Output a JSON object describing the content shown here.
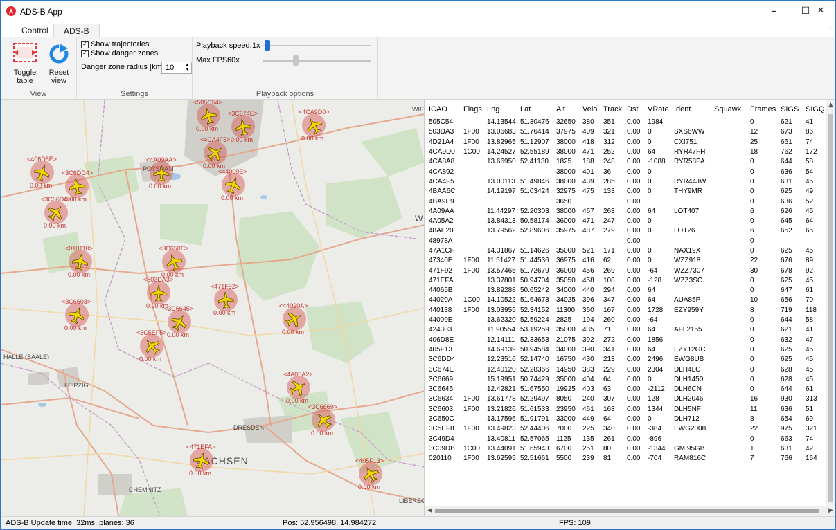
{
  "window": {
    "title": "ADS-B App",
    "minimize": "–",
    "maximize": "☐",
    "close": "✕"
  },
  "tabs": [
    {
      "label": "Control"
    },
    {
      "label": "ADS-B"
    }
  ],
  "ribbon": {
    "view": {
      "label": "View",
      "toggle_table": "Toggle\ntable",
      "toggle_table_l1": "Toggle",
      "toggle_table_l2": "table",
      "reset_view_l1": "Reset",
      "reset_view_l2": "view"
    },
    "settings": {
      "label": "Settings",
      "show_trajectories": "Show trajectories",
      "show_danger_zones": "Show danger zones",
      "danger_radius_label": "Danger zone radius [km]",
      "danger_radius_value": "10"
    },
    "playback": {
      "label": "Playback options",
      "speed_label": "Playback speed:",
      "speed_value": "1x",
      "speed_level": 0.02,
      "fps_label": "Max FPS:",
      "fps_value": "60x",
      "fps_level": 0.3
    }
  },
  "map": {
    "places": [
      {
        "name": "W"
      },
      {
        "name": "WIE"
      },
      {
        "name": "HALLE (SAALE)"
      },
      {
        "name": "LEIPZIG"
      },
      {
        "name": "CHEMNITZ"
      },
      {
        "name": "DRESDEN"
      },
      {
        "name": "POTSDAM"
      },
      {
        "name": "SACHSEN"
      },
      {
        "name": "LIBEREC"
      }
    ],
    "planes": [
      {
        "label": "<4CA9D0>",
        "dist": "0.00 km"
      },
      {
        "label": "<406D8E>",
        "dist": "0.00 km"
      },
      {
        "label": "<3C6DD4>",
        "dist": "0.00 km"
      },
      {
        "label": "<3C66D4>",
        "dist": "0.00 km"
      },
      {
        "label": "<010110>",
        "dist": "0.00 km"
      },
      {
        "label": "<3C650C>",
        "dist": "0.00 km"
      },
      {
        "label": "<503DA3>",
        "dist": "0.00 km"
      },
      {
        "label": "<471F92>",
        "dist": "0.00 km"
      },
      {
        "label": "<3C6645>",
        "dist": "0.00 km"
      },
      {
        "label": "<3C6603>",
        "dist": "0.00 km"
      },
      {
        "label": "<3C5EF5>",
        "dist": "0.00 km"
      },
      {
        "label": "<44020A>",
        "dist": "0.00 km"
      },
      {
        "label": "<505C54>",
        "dist": "0.00 km"
      },
      {
        "label": "<471EFA>",
        "dist": "0.00 km"
      },
      {
        "label": "<405F13>",
        "dist": "0.00 km"
      },
      {
        "label": "<4A09AA>",
        "dist": "0.00 km"
      },
      {
        "label": "<4A05A2>",
        "dist": "0.00 km"
      },
      {
        "label": "<44009E>",
        "dist": "0.00 km"
      },
      {
        "label": "<3C6669>",
        "dist": "0.00 km"
      },
      {
        "label": "<4CA4F5>",
        "dist": "0.00 km"
      },
      {
        "label": "<3C674E>",
        "dist": "0.00 km"
      }
    ]
  },
  "table": {
    "columns": [
      "ICAO",
      "Flags",
      "Lng",
      "Lat",
      "Alt",
      "Velo",
      "Track",
      "Dst",
      "VRate",
      "Ident",
      "Squawk",
      "Frames",
      "SIGS",
      "SIGQ"
    ],
    "rows": [
      [
        "505C54",
        "",
        "14.13544",
        "51.30476",
        "32650",
        "380",
        "351",
        "0.00",
        "1984",
        "",
        "",
        "0",
        "621",
        "41"
      ],
      [
        "503DA3",
        "1F00",
        "13.06683",
        "51.76414",
        "37975",
        "409",
        "321",
        "0.00",
        "0",
        "SXS6WW",
        "",
        "12",
        "673",
        "86"
      ],
      [
        "4D21A4",
        "1F00",
        "13.82965",
        "51.12907",
        "38000",
        "418",
        "312",
        "0.00",
        "0",
        "CXI751",
        "",
        "25",
        "661",
        "74"
      ],
      [
        "4CA9D0",
        "1C00",
        "14.24527",
        "52.55189",
        "38000",
        "471",
        "252",
        "0.00",
        "64",
        "RYR47FH",
        "",
        "18",
        "762",
        "172"
      ],
      [
        "4CA8A8",
        "",
        "13.66950",
        "52.41130",
        "1825",
        "188",
        "248",
        "0.00",
        "-1088",
        "RYR58PA",
        "",
        "0",
        "644",
        "58"
      ],
      [
        "4CA892",
        "",
        "",
        "",
        "38000",
        "401",
        "36",
        "0.00",
        "0",
        "",
        "",
        "0",
        "636",
        "54"
      ],
      [
        "4CA4F5",
        "",
        "13.00113",
        "51.49846",
        "38000",
        "439",
        "285",
        "0.00",
        "0",
        "RYR44JW",
        "",
        "0",
        "631",
        "45"
      ],
      [
        "4BAA6C",
        "",
        "14.19197",
        "51.03424",
        "32975",
        "475",
        "133",
        "0.00",
        "0",
        "THY9MR",
        "",
        "0",
        "625",
        "49"
      ],
      [
        "4BA9E9",
        "",
        "",
        "",
        "3650",
        "",
        "",
        "0.00",
        "",
        "",
        "",
        "0",
        "636",
        "52"
      ],
      [
        "4A09AA",
        "",
        "11.44297",
        "52.20303",
        "38000",
        "467",
        "263",
        "0.00",
        "64",
        "LOT407",
        "",
        "6",
        "626",
        "45"
      ],
      [
        "4A05A2",
        "",
        "13.84313",
        "50.58174",
        "36000",
        "471",
        "247",
        "0.00",
        "0",
        "",
        "",
        "0",
        "645",
        "64"
      ],
      [
        "48AE20",
        "",
        "13.79562",
        "52.89606",
        "35975",
        "487",
        "279",
        "0.00",
        "0",
        "LOT26",
        "",
        "6",
        "652",
        "65"
      ],
      [
        "48978A",
        "",
        "",
        "",
        "",
        "",
        "",
        "0.00",
        "",
        "",
        "",
        "0",
        "",
        ""
      ],
      [
        "47A1CF",
        "",
        "14.31867",
        "51.14626",
        "35000",
        "521",
        "171",
        "0.00",
        "0",
        "NAX19X",
        "",
        "0",
        "625",
        "45"
      ],
      [
        "47340E",
        "1F00",
        "11.51427",
        "51.44536",
        "36975",
        "416",
        "62",
        "0.00",
        "0",
        "WZZ918",
        "",
        "22",
        "676",
        "89"
      ],
      [
        "471F92",
        "1F00",
        "13.57465",
        "51.72679",
        "36000",
        "456",
        "269",
        "0.00",
        "-64",
        "WZZ7307",
        "",
        "30",
        "678",
        "92"
      ],
      [
        "471EFA",
        "",
        "13.37801",
        "50.94704",
        "35050",
        "458",
        "108",
        "0.00",
        "-128",
        "WZZ3SC",
        "",
        "0",
        "625",
        "45"
      ],
      [
        "44065B",
        "",
        "13.89288",
        "50.65242",
        "34000",
        "440",
        "294",
        "0.00",
        "64",
        "",
        "",
        "0",
        "647",
        "61"
      ],
      [
        "44020A",
        "1C00",
        "14.10522",
        "51.64673",
        "34025",
        "396",
        "347",
        "0.00",
        "64",
        "AUA85P",
        "",
        "10",
        "656",
        "70"
      ],
      [
        "440138",
        "1F00",
        "13.03955",
        "52.34152",
        "11300",
        "360",
        "167",
        "0.00",
        "1728",
        "EZY959Y",
        "",
        "8",
        "719",
        "118"
      ],
      [
        "44009E",
        "",
        "13.62320",
        "52.59224",
        "2825",
        "194",
        "260",
        "0.00",
        "-64",
        "",
        "",
        "0",
        "644",
        "58"
      ],
      [
        "424303",
        "",
        "11.90554",
        "53.19259",
        "35000",
        "435",
        "71",
        "0.00",
        "64",
        "AFL2155",
        "",
        "0",
        "621",
        "41"
      ],
      [
        "406D8E",
        "",
        "12.14111",
        "52.33653",
        "21075",
        "392",
        "272",
        "0.00",
        "1856",
        "",
        "",
        "0",
        "632",
        "47"
      ],
      [
        "405F13",
        "",
        "14.69139",
        "50.94584",
        "34000",
        "390",
        "341",
        "0.00",
        "64",
        "EZY12GC",
        "",
        "0",
        "625",
        "45"
      ],
      [
        "3C6DD4",
        "",
        "12.23516",
        "52.14740",
        "16750",
        "430",
        "213",
        "0.00",
        "2496",
        "EWG8UB",
        "",
        "0",
        "625",
        "45"
      ],
      [
        "3C674E",
        "",
        "12.40120",
        "52.28366",
        "14950",
        "383",
        "229",
        "0.00",
        "2304",
        "DLH4LC",
        "",
        "0",
        "628",
        "45"
      ],
      [
        "3C6669",
        "",
        "15.19951",
        "50.74429",
        "35000",
        "404",
        "64",
        "0.00",
        "0",
        "DLH1450",
        "",
        "0",
        "628",
        "45"
      ],
      [
        "3C6645",
        "",
        "12.42821",
        "51.67550",
        "19925",
        "403",
        "63",
        "0.00",
        "-2112",
        "DLH6CN",
        "",
        "0",
        "644",
        "61"
      ],
      [
        "3C6634",
        "1F00",
        "13.61778",
        "52.29497",
        "8050",
        "240",
        "307",
        "0.00",
        "128",
        "DLH2046",
        "",
        "16",
        "930",
        "313"
      ],
      [
        "3C6603",
        "1F00",
        "13.21826",
        "51.61533",
        "23950",
        "461",
        "163",
        "0.00",
        "1344",
        "DLH5NF",
        "",
        "11",
        "636",
        "51"
      ],
      [
        "3C650C",
        "",
        "13.17596",
        "51.91791",
        "33000",
        "449",
        "64",
        "0.00",
        "0",
        "DLH712",
        "",
        "8",
        "654",
        "69"
      ],
      [
        "3C5EF8",
        "1F00",
        "13.49823",
        "52.44406",
        "7000",
        "225",
        "340",
        "0.00",
        "-384",
        "EWG2008",
        "",
        "22",
        "975",
        "321"
      ],
      [
        "3C49D4",
        "",
        "13.40811",
        "52.57065",
        "1125",
        "135",
        "261",
        "0.00",
        "-896",
        "",
        "",
        "0",
        "663",
        "74"
      ],
      [
        "3C09DB",
        "1C00",
        "13.44091",
        "51.65943",
        "6700",
        "251",
        "80",
        "0.00",
        "-1344",
        "GMI95GB",
        "",
        "1",
        "631",
        "42"
      ],
      [
        "020110",
        "1F00",
        "13.62595",
        "52.51661",
        "5500",
        "239",
        "81",
        "0.00",
        "-704",
        "RAM816C",
        "",
        "7",
        "766",
        "164"
      ]
    ]
  },
  "status": {
    "update": "ADS-B Update time: 32ms, planes: 36",
    "pos": "Pos: 52.956498, 14.984272",
    "fps": "FPS: 109"
  },
  "colors": {
    "accent": "#2b79c4",
    "plane": "#f2d600",
    "halo": "#d9534f",
    "label": "#c9302c"
  }
}
